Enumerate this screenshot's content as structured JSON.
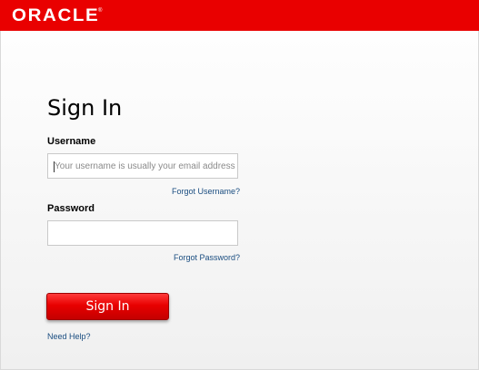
{
  "header": {
    "logo_text": "ORACLE",
    "logo_mark": "®",
    "brand_color": "#e90000"
  },
  "form": {
    "title": "Sign In",
    "username": {
      "label": "Username",
      "value": "",
      "placeholder": "Your username is usually your email address",
      "forgot_link": "Forgot Username?"
    },
    "password": {
      "label": "Password",
      "value": "",
      "placeholder": "",
      "forgot_link": "Forgot Password?"
    },
    "submit_label": "Sign In",
    "help_link": "Need Help?"
  }
}
